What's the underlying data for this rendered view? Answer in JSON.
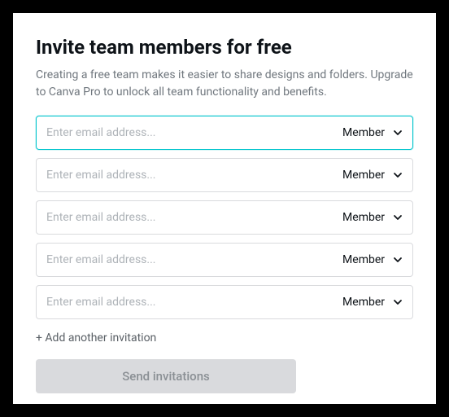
{
  "title": "Invite team members for free",
  "description": "Creating a free team makes it easier to share designs and folders. Upgrade to Canva Pro to unlock all team functionality and benefits.",
  "invitations": [
    {
      "placeholder": "Enter email address...",
      "role": "Member",
      "active": true
    },
    {
      "placeholder": "Enter email address...",
      "role": "Member",
      "active": false
    },
    {
      "placeholder": "Enter email address...",
      "role": "Member",
      "active": false
    },
    {
      "placeholder": "Enter email address...",
      "role": "Member",
      "active": false
    },
    {
      "placeholder": "Enter email address...",
      "role": "Member",
      "active": false
    }
  ],
  "addAnotherLabel": "+ Add another invitation",
  "sendButtonLabel": "Send invitations"
}
